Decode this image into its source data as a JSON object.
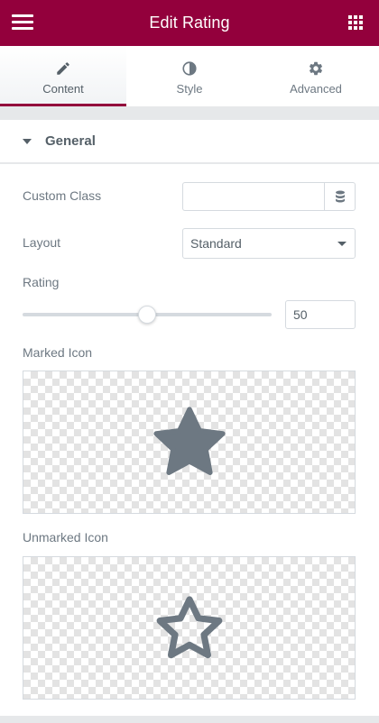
{
  "header": {
    "title": "Edit Rating",
    "menu_icon": "hamburger-icon",
    "apps_icon": "grid-icon",
    "background": "#93003c"
  },
  "tabs": [
    {
      "label": "Content",
      "icon": "pencil-icon",
      "active": true
    },
    {
      "label": "Style",
      "icon": "half-circle-icon",
      "active": false
    },
    {
      "label": "Advanced",
      "icon": "gear-icon",
      "active": false
    }
  ],
  "section": {
    "title": "General",
    "expanded": true
  },
  "controls": {
    "custom_class": {
      "label": "Custom Class",
      "value": "",
      "dynamic_icon": "database-icon"
    },
    "layout": {
      "label": "Layout",
      "value": "Standard"
    },
    "rating": {
      "label": "Rating",
      "value": "50",
      "fraction": 0.5
    },
    "marked_icon": {
      "label": "Marked Icon",
      "icon": "star-filled-icon"
    },
    "unmarked_icon": {
      "label": "Unmarked Icon",
      "icon": "star-outline-icon"
    }
  },
  "colors": {
    "accent": "#93003c",
    "icon": "#6d7882"
  }
}
